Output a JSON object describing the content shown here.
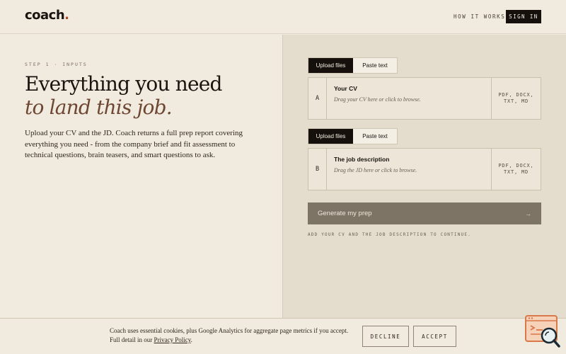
{
  "header": {
    "logo_text": "coach",
    "logo_dot": ".",
    "nav_link": "HOW IT WORKS",
    "signin_label": "SIGN IN"
  },
  "hero": {
    "step_label": "STEP 1 · INPUTS",
    "headline_line1": "Everything you need",
    "headline_line2": "to land this job.",
    "description": "Upload your CV and the JD. Coach returns a full prep report covering everything you need - from the company brief and fit assessment to technical questions, brain teasers, and smart questions to ask."
  },
  "inputs": [
    {
      "tabs": {
        "upload": "Upload files",
        "paste": "Paste text",
        "active": "upload"
      },
      "letter": "A",
      "title": "Your CV",
      "hint": "Drag your CV here or click to browse.",
      "formats_line1": "PDF, DOCX,",
      "formats_line2": "TXT, MD"
    },
    {
      "tabs": {
        "upload": "Upload files",
        "paste": "Paste text",
        "active": "upload"
      },
      "letter": "B",
      "title": "The job description",
      "hint": "Drag the JD here or click to browse.",
      "formats_line1": "PDF, DOCX,",
      "formats_line2": "TXT, MD"
    }
  ],
  "generate": {
    "label": "Generate my prep",
    "arrow": "→",
    "helper": "ADD YOUR CV AND THE JOB DESCRIPTION TO CONTINUE."
  },
  "cookie": {
    "text_before": "Coach uses essential cookies, plus Google Analytics for aggregate page metrics if you accept. Full detail in our ",
    "link": "Privacy Policy",
    "text_after": ".",
    "decline_label": "DECLINE",
    "accept_label": "ACCEPT"
  },
  "colors": {
    "background": "#f1ebdf",
    "panel": "#e4dccd",
    "dark": "#15100c",
    "accent_italic": "#6e4733",
    "logo_dot": "#b04a2a",
    "generate_button": "#7e7466",
    "chat_widget": "#d9784a"
  },
  "icons": {
    "chat_widget": "chat-search-icon"
  }
}
